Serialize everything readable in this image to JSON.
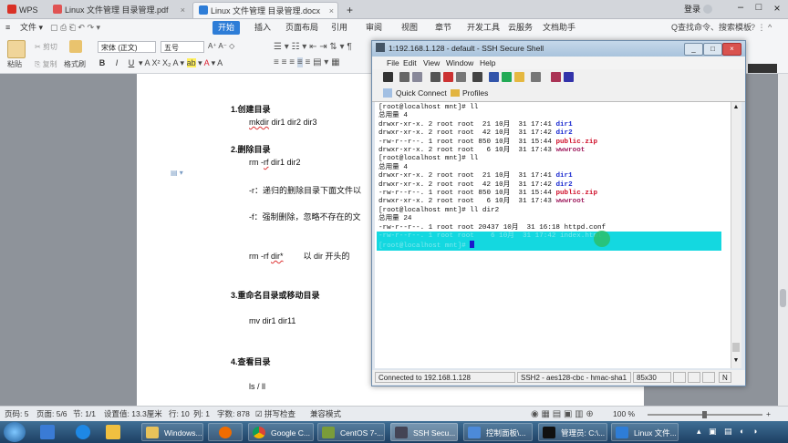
{
  "tabs": [
    {
      "label": "WPS"
    },
    {
      "label": "Linux 文件管理 目录管理.pdf"
    },
    {
      "label": "Linux 文件管理 目录管理.docx"
    },
    {
      "label": "+"
    }
  ],
  "window_controls": {
    "user": "登录",
    "minimize": "–",
    "maximize": "□",
    "close": "×"
  },
  "menu": {
    "file": "文件",
    "items": [
      "开始",
      "插入",
      "页面布局",
      "引用",
      "审阅",
      "视图",
      "章节",
      "开发工具",
      "云服务",
      "文档助手"
    ],
    "search": "Q查找命令、搜索模板"
  },
  "ribbon": {
    "paste": "粘贴",
    "cut": "剪切",
    "copy": "复制",
    "format_painter": "格式刷",
    "font_family": "宋体 (正文)",
    "font_size": "五号",
    "bold": "B",
    "italic": "I",
    "underline": "U",
    "strike": "A"
  },
  "document": {
    "s1_title": "1.创建目录",
    "s1_cmd_pre": "mkdir",
    "s1_cmd_post": " dir1  dir2 dir3",
    "s2_title": "2.删除目录",
    "s2_cmd_pre": "rm -",
    "s2_cmd_rf": "rf",
    "s2_cmd_post": " dir1  dir2",
    "s2_note_r": "-r：递归的删除目录下面文件以",
    "s2_note_f": "-f：强制删除，忽略不存在的文",
    "s2_glob_pre": "rm  -rf   ",
    "s2_glob_dir": "dir*",
    "s2_glob_note": "以 dir 开头的",
    "s3_title": "3.重命名目录或移动目录",
    "s3_cmd": "mv dir1  dir11",
    "s4_title": "4.查看目录",
    "s4_cmd": "ls   / ll"
  },
  "ssh": {
    "title": "1:192.168.1.128 - default - SSH Secure Shell",
    "menu": [
      "File",
      "Edit",
      "View",
      "Window",
      "Help"
    ],
    "quick_connect": "Quick Connect",
    "profiles": "Profiles",
    "terminal": {
      "prompt1": "[root@localhost mnt]# ll",
      "total1": "总用量 4",
      "rows1": [
        {
          "meta": "drwxr-xr-x. 2 root root  21 10月  31 17:41 ",
          "name": "dir1",
          "kind": "dir"
        },
        {
          "meta": "drwxr-xr-x. 2 root root  42 10月  31 17:42 ",
          "name": "dir2",
          "kind": "dir"
        },
        {
          "meta": "-rw-r--r--. 1 root root 850 10月  31 15:44 ",
          "name": "public.zip",
          "kind": "zip"
        },
        {
          "meta": "drwxr-xr-x. 2 root root   6 10月  31 17:43 ",
          "name": "wwwroot",
          "kind": "www"
        }
      ],
      "prompt2": "[root@localhost mnt]# ll",
      "total2": "总用量 4",
      "rows2": [
        {
          "meta": "drwxr-xr-x. 2 root root  21 10月  31 17:41 ",
          "name": "dir1",
          "kind": "dir"
        },
        {
          "meta": "drwxr-xr-x. 2 root root  42 10月  31 17:42 ",
          "name": "dir2",
          "kind": "dir"
        },
        {
          "meta": "-rw-r--r--. 1 root root 850 10月  31 15:44 ",
          "name": "public.zip",
          "kind": "zip"
        },
        {
          "meta": "drwxr-xr-x. 2 root root   6 10月  31 17:43 ",
          "name": "wwwroot",
          "kind": "www"
        }
      ],
      "prompt3": "[root@localhost mnt]# ll dir2",
      "total3": "总用量 24",
      "row3": "-rw-r--r--. 1 root root 20437 10月  31 16:18 httpd.conf",
      "hl_line1": "-rw-r--r--. 1 root root    6 10月  31 17:42 index.html",
      "hl_line2": "[root@localhost mnt]# "
    },
    "status": {
      "connected": "Connected to 192.168.1.128",
      "cipher": "SSH2 - aes128-cbc - hmac-sha1",
      "size": "85x30",
      "num": "N"
    }
  },
  "statusbar": {
    "page": "页码: 5",
    "pages": "页面: 5/6",
    "section": "节: 1/1",
    "setting": "设置值: 13.3厘米",
    "row": "行: 10",
    "col": "列: 1",
    "words": "字数: 878",
    "spell": "拼写检查",
    "compat": "兼容模式",
    "zoom": "100 %"
  },
  "taskbar": {
    "items": [
      "Windows...",
      "",
      "Google C...",
      "",
      "CentOS 7-...",
      "SSH Secu...",
      "控制面板\\...",
      "管理员: C:\\...",
      "Linux 文件..."
    ]
  },
  "colors": {
    "wps_blue": "#2e7dd7",
    "terminal_highlight": "#14d8e0",
    "dir_color": "#1a2ad0",
    "zip_color": "#d0102a"
  }
}
